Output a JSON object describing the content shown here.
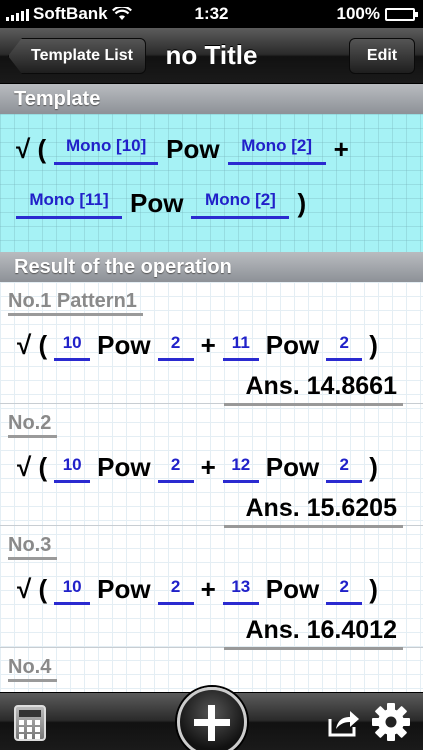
{
  "status_bar": {
    "carrier": "SoftBank",
    "time": "1:32",
    "battery": "100%",
    "battery_level": 1.0
  },
  "nav": {
    "back_label": "Template List",
    "title": "no Title",
    "edit_label": "Edit"
  },
  "template": {
    "header": "Template",
    "line1": {
      "open": "√ (",
      "a": "Mono [10]",
      "op": "Pow",
      "b": "Mono [2]",
      "plus": "+"
    },
    "line2": {
      "a": "Mono [11]",
      "op": "Pow",
      "b": "Mono [2]",
      "close": ")"
    }
  },
  "results": {
    "header": "Result of the operation",
    "items": [
      {
        "title": "No.1 Pattern1",
        "open": "√ (",
        "a": "10",
        "pow1": "Pow",
        "b": "2",
        "plus": "+",
        "c": "11",
        "pow2": "Pow",
        "d": "2",
        "close": ")",
        "answer": "Ans. 14.8661"
      },
      {
        "title": "No.2",
        "open": "√ (",
        "a": "10",
        "pow1": "Pow",
        "b": "2",
        "plus": "+",
        "c": "12",
        "pow2": "Pow",
        "d": "2",
        "close": ")",
        "answer": "Ans. 15.6205"
      },
      {
        "title": "No.3",
        "open": "√ (",
        "a": "10",
        "pow1": "Pow",
        "b": "2",
        "plus": "+",
        "c": "13",
        "pow2": "Pow",
        "d": "2",
        "close": ")",
        "answer": "Ans. 16.4012"
      },
      {
        "title": "No.4"
      }
    ]
  }
}
